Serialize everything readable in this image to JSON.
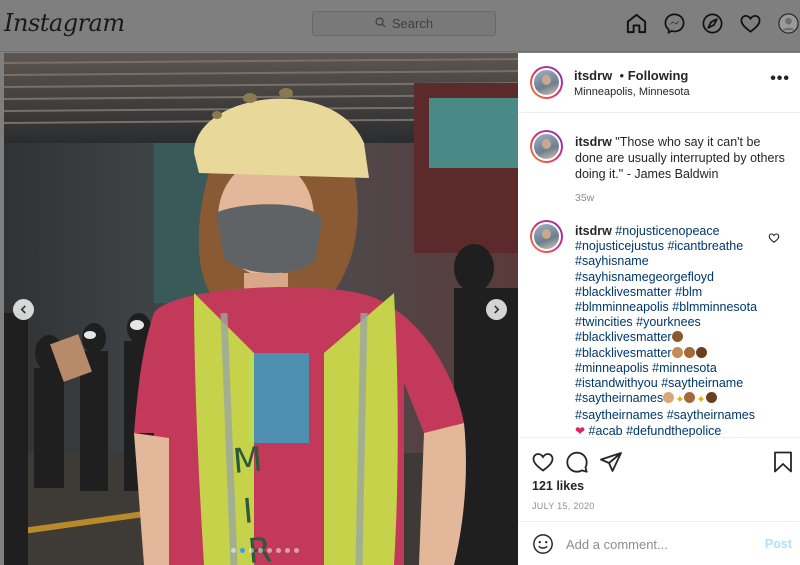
{
  "topbar": {
    "logo": "Instagram",
    "search_placeholder": "Search",
    "nav_icons": [
      "home-icon",
      "messenger-icon",
      "explore-icon",
      "heart-icon",
      "profile-icon"
    ]
  },
  "post": {
    "username": "itsdrw",
    "follow_status": "Following",
    "location": "Minneapolis, Minnesota",
    "caption_author": "itsdrw",
    "caption": "\"Those who say it can't be done are usually interrupted by others doing it.\" - James Baldwin",
    "caption_time": "35w",
    "comment_author": "itsdrw",
    "hashtags": {
      "line1": "#nojusticenopeace",
      "line2a": "#nojusticejustus",
      "line2b": "#icantbreathe",
      "line3": "#sayhisname",
      "line4": "#sayhisnamegeorgefloyd",
      "line5a": "#blacklivesmatter",
      "line5b": "#blm",
      "line6a": "#blmminneapolis",
      "line6b": "#blmminnesota",
      "line7a": "#twincities",
      "line7b": "#yourknees",
      "line8": "#blacklivesmatter",
      "line9": "#blacklivesmatter",
      "line10a": "#minneapolis",
      "line10b": "#minnesota",
      "line11a": "#istandwithyou",
      "line11b": "#saytheirname",
      "line12": "#saytheirnames",
      "line13a": "#saytheirnames",
      "line13b": "#saytheirnames",
      "line14a": "#acab",
      "line14b": "#defundthepolice"
    },
    "likes": "121 likes",
    "date": "JULY 15, 2020",
    "comment_placeholder": "Add a comment...",
    "post_label": "Post",
    "carousel_count": 8,
    "carousel_active": 1
  },
  "colors": {
    "hashtag": "#00376b",
    "post_button": "#b2dffc",
    "carousel_active": "#3d9bf0"
  }
}
